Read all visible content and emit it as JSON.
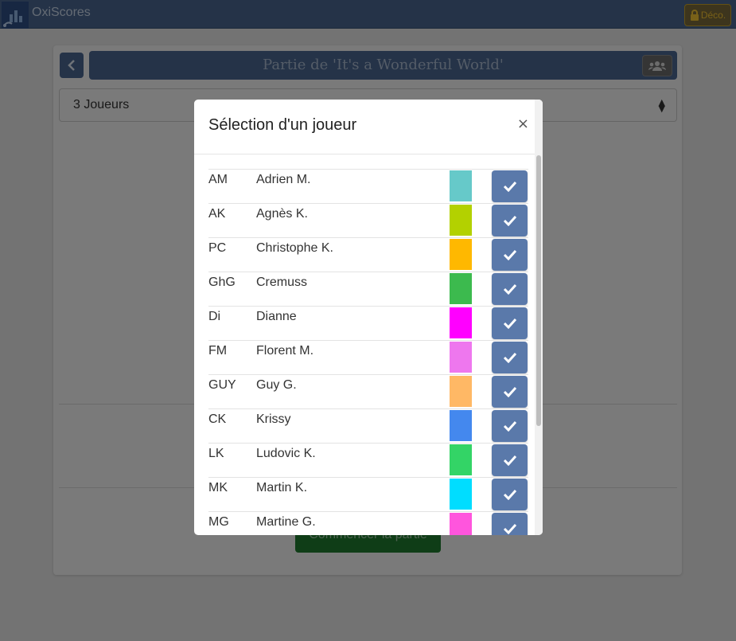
{
  "app": {
    "brand": "OxiScores",
    "logout_label": "Déco."
  },
  "header": {
    "title": "Partie de 'It's a Wonderful World'"
  },
  "players_select": {
    "value": "3 Joueurs"
  },
  "start_button": {
    "label": "Commencer la partie"
  },
  "modal": {
    "title": "Sélection d'un joueur",
    "close_label": "×",
    "players": [
      {
        "code": "AM",
        "name": "Adrien M.",
        "color": "#66c9c9"
      },
      {
        "code": "AK",
        "name": "Agnès K.",
        "color": "#b3d100"
      },
      {
        "code": "PC",
        "name": "Christophe K.",
        "color": "#ffb800"
      },
      {
        "code": "GhG",
        "name": "Cremuss",
        "color": "#3cba4e"
      },
      {
        "code": "Di",
        "name": "Dianne",
        "color": "#ff00ff"
      },
      {
        "code": "FM",
        "name": "Florent M.",
        "color": "#ee77ee"
      },
      {
        "code": "GUY",
        "name": "Guy G.",
        "color": "#ffb865"
      },
      {
        "code": "CK",
        "name": "Krissy",
        "color": "#4488ee"
      },
      {
        "code": "LK",
        "name": "Ludovic K.",
        "color": "#33d466"
      },
      {
        "code": "MK",
        "name": "Martin K.",
        "color": "#00ddff"
      },
      {
        "code": "MG",
        "name": "Martine G.",
        "color": "#ff55dd"
      }
    ]
  },
  "icons": {
    "back": "chevron-left-icon",
    "group": "users-icon",
    "lock": "lock-icon",
    "select": "sort-icon",
    "check": "check-icon"
  }
}
